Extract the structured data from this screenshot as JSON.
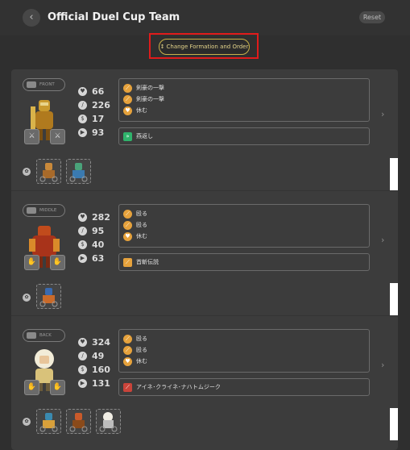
{
  "header": {
    "back_icon": "chevron-left-icon",
    "title": "Official Duel Cup Team",
    "reset_label": "Reset",
    "formation_button": "Change Formation and Order",
    "formation_icon": "↕"
  },
  "colors": {
    "accent_gold": "#c9b24a",
    "highlight_red": "#e01b1b",
    "skill_orange": "#e6a23c",
    "ult_green": "#2fb36b",
    "ult_red": "#c9443a"
  },
  "slots": [
    {
      "position": "FRONT",
      "stats": {
        "hp": "66",
        "atk": "226",
        "def": "17",
        "spd": "93"
      },
      "skills": [
        "剣豪の一撃",
        "剣豪の一撃",
        "休む"
      ],
      "ultimate": "燕返し",
      "ultimate_color": "#2fb36b"
    },
    {
      "position": "MIDDLE",
      "stats": {
        "hp": "282",
        "atk": "95",
        "def": "40",
        "spd": "63"
      },
      "skills": [
        "殴る",
        "殴る",
        "休む"
      ],
      "ultimate": "首斬伝説",
      "ultimate_color": "#e6a23c"
    },
    {
      "position": "BACK",
      "stats": {
        "hp": "324",
        "atk": "49",
        "def": "160",
        "spd": "131"
      },
      "skills": [
        "殴る",
        "殴る",
        "休む"
      ],
      "ultimate": "アイネ･クライネ･ナハトムジーク",
      "ultimate_color": "#c9443a"
    }
  ]
}
